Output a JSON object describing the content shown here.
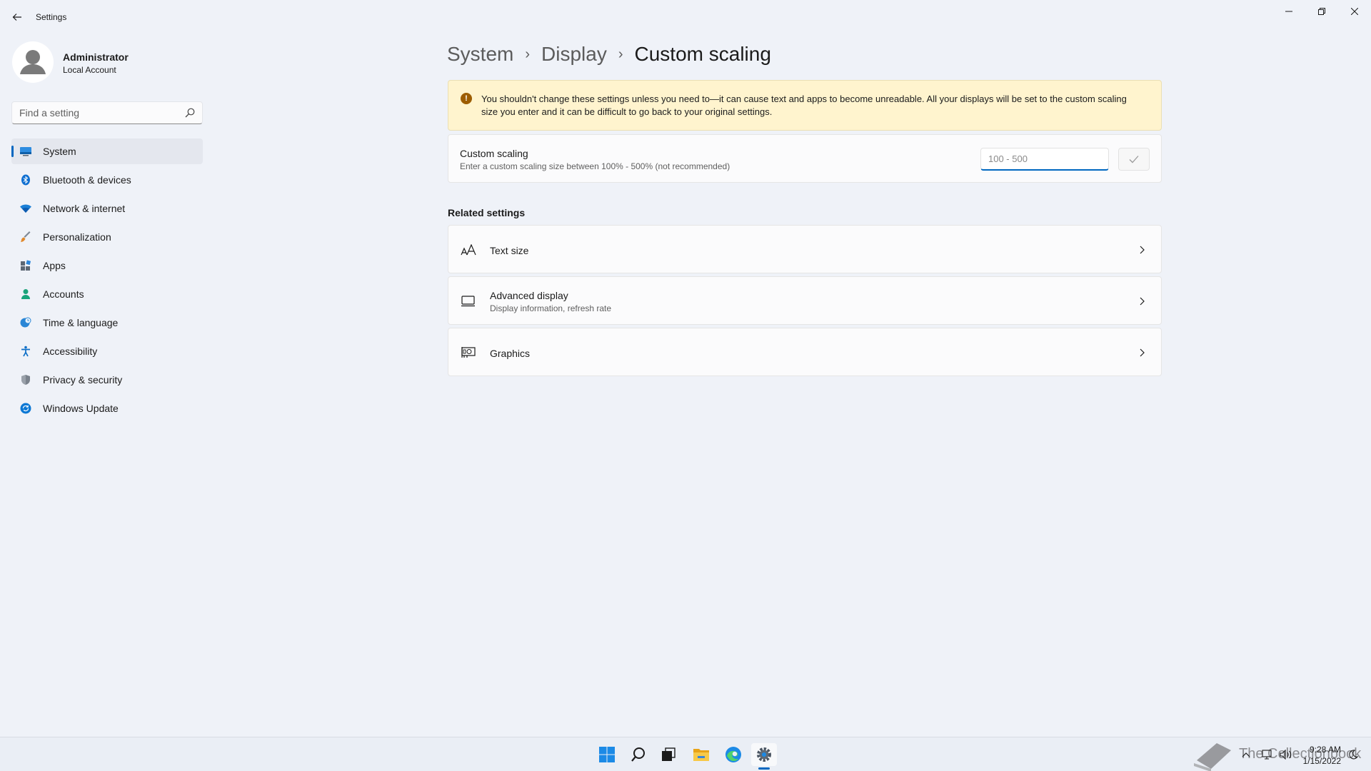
{
  "app": {
    "title": "Settings"
  },
  "profile": {
    "name": "Administrator",
    "account_type": "Local Account"
  },
  "search": {
    "placeholder": "Find a setting"
  },
  "nav": {
    "items": [
      {
        "label": "System",
        "icon": "system-icon",
        "color": "#0067c0",
        "active": true
      },
      {
        "label": "Bluetooth & devices",
        "icon": "bluetooth-icon",
        "color": "#0067c0"
      },
      {
        "label": "Network & internet",
        "icon": "wifi-icon",
        "color": "#0b6bcb"
      },
      {
        "label": "Personalization",
        "icon": "brush-icon",
        "color": "#d97a2b"
      },
      {
        "label": "Apps",
        "icon": "apps-icon",
        "color": "#54606e"
      },
      {
        "label": "Accounts",
        "icon": "person-icon",
        "color": "#1aa37a"
      },
      {
        "label": "Time & language",
        "icon": "globe-clock-icon",
        "color": "#2a86d6"
      },
      {
        "label": "Accessibility",
        "icon": "accessibility-icon",
        "color": "#0d6fc7"
      },
      {
        "label": "Privacy & security",
        "icon": "shield-icon",
        "color": "#6f7782"
      },
      {
        "label": "Windows Update",
        "icon": "update-icon",
        "color": "#0d78d4"
      }
    ]
  },
  "breadcrumb": {
    "level1": "System",
    "level2": "Display",
    "current": "Custom scaling",
    "separator": "›"
  },
  "warning": {
    "icon": "warning-icon",
    "icon_glyph": "!",
    "text": "You shouldn't change these settings unless you need to—it can cause text and apps to become unreadable. All your displays will be set to the custom scaling size you enter and it can be difficult to go back to your original settings.",
    "color": "#fff4ce"
  },
  "custom_scaling": {
    "title": "Custom scaling",
    "description": "Enter a custom scaling size between 100% - 500% (not recommended)",
    "input_placeholder": "100 - 500",
    "input_value": ""
  },
  "related": {
    "title": "Related settings",
    "items": [
      {
        "title": "Text size",
        "subtitle": "",
        "icon": "text-size-icon"
      },
      {
        "title": "Advanced display",
        "subtitle": "Display information, refresh rate",
        "icon": "monitor-icon"
      },
      {
        "title": "Graphics",
        "subtitle": "",
        "icon": "graphics-card-icon"
      }
    ]
  },
  "taskbar": {
    "apps": [
      "windows-start-icon",
      "search-icon",
      "task-view-icon",
      "file-explorer-icon",
      "edge-icon",
      "settings-icon"
    ],
    "active_app": "settings-icon",
    "clock": {
      "time": "9:28 AM",
      "date": "1/15/2022"
    },
    "watermark": "The Collectionbook"
  },
  "colors": {
    "accent": "#0067c0",
    "background": "#eff2f8",
    "card": "#fbfbfc"
  }
}
